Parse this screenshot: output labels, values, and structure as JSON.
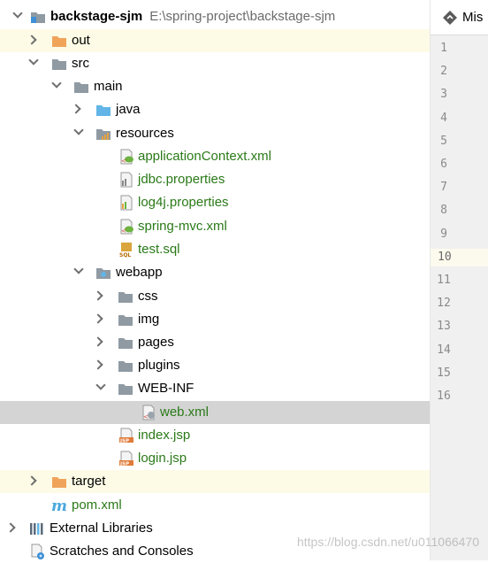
{
  "tree": {
    "root": {
      "label": "backstage-sjm",
      "path": "E:\\spring-project\\backstage-sjm"
    },
    "items": [
      {
        "label": "out"
      },
      {
        "label": "src"
      },
      {
        "label": "main"
      },
      {
        "label": "java"
      },
      {
        "label": "resources"
      },
      {
        "label": "applicationContext.xml"
      },
      {
        "label": "jdbc.properties"
      },
      {
        "label": "log4j.properties"
      },
      {
        "label": "spring-mvc.xml"
      },
      {
        "label": "test.sql"
      },
      {
        "label": "webapp"
      },
      {
        "label": "css"
      },
      {
        "label": "img"
      },
      {
        "label": "pages"
      },
      {
        "label": "plugins"
      },
      {
        "label": "WEB-INF"
      },
      {
        "label": "web.xml"
      },
      {
        "label": "index.jsp"
      },
      {
        "label": "login.jsp"
      },
      {
        "label": "target"
      },
      {
        "label": "pom.xml"
      },
      {
        "label": "External Libraries"
      },
      {
        "label": "Scratches and Consoles"
      }
    ]
  },
  "editor": {
    "tab_label": "Mis",
    "line_numbers": [
      "1",
      "2",
      "3",
      "4",
      "5",
      "6",
      "7",
      "8",
      "9",
      "10",
      "11",
      "12",
      "13",
      "14",
      "15",
      "16"
    ]
  },
  "watermark": "https://blog.csdn.net/u011066470",
  "colors": {
    "folder": "#8f9aa3",
    "excluded_folder": "#f0a45a",
    "source_folder": "#62b5e6",
    "file_text_green": "#2a7a18",
    "selection": "#d4d4d4",
    "highlight_row": "#fdfbe6"
  }
}
